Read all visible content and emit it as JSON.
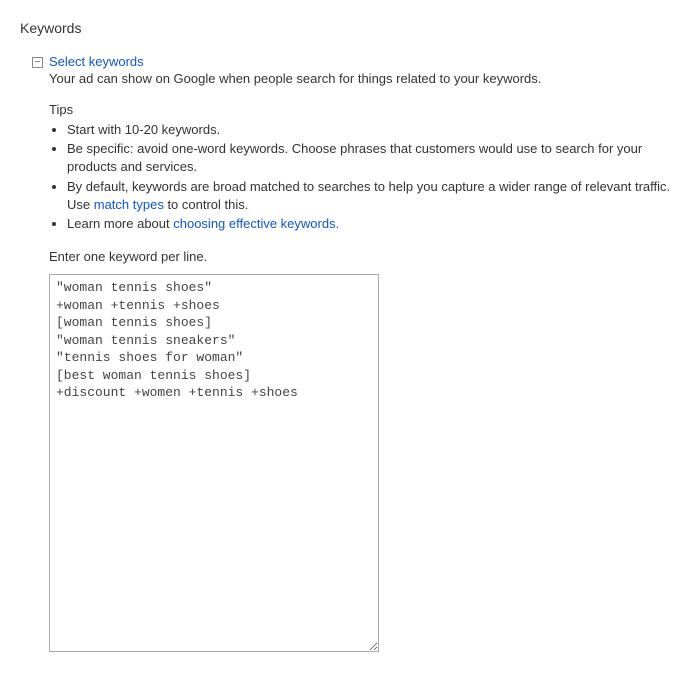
{
  "section": {
    "title": "Keywords"
  },
  "header": {
    "link_label": "Select keywords",
    "description": "Your ad can show on Google when people search for things related to your keywords."
  },
  "tips": {
    "label": "Tips",
    "items": {
      "0": "Start with 10-20 keywords.",
      "1": "Be specific: avoid one-word keywords. Choose phrases that customers would use to search for your products and services.",
      "2_pre": "By default, keywords are broad matched to searches to help you capture a wider range of relevant traffic. Use ",
      "2_link": "match types",
      "2_post": " to control this.",
      "3_pre": "Learn more about ",
      "3_link": "choosing effective keywords."
    }
  },
  "input": {
    "label": "Enter one keyword per line.",
    "value": "\"woman tennis shoes\"\n+woman +tennis +shoes\n[woman tennis shoes]\n\"woman tennis sneakers\"\n\"tennis shoes for woman\"\n[best woman tennis shoes]\n+discount +women +tennis +shoes"
  }
}
